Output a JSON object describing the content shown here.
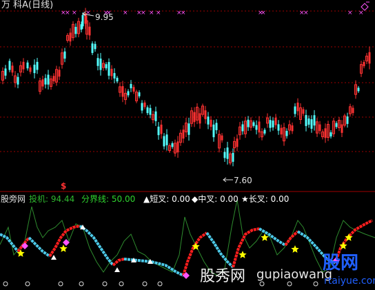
{
  "header": {
    "title": "万 科A(日线)"
  },
  "price_panel": {
    "high_label": "9.95",
    "low_label": "7.60"
  },
  "indicator_bar": {
    "name": "股旁网",
    "touji_label": "投机: 94.44",
    "boundary_label": "分界线: 50.00",
    "short_cross": "▲短叉: 0.00",
    "mid_cross": "◆中叉: 0.00",
    "long_cross": "★长叉: 0.00"
  },
  "misc": {
    "dollar": "$"
  },
  "watermark": {
    "text1": "股秀网",
    "text2": "gupiaowang",
    "text3": "rtaiyue.com",
    "logo_text": "股网"
  },
  "colors": {
    "bg": "#000000",
    "up": "#ff3232",
    "down": "#54ffff",
    "title": "#e0e0e0",
    "dashed_grid": "#a00000",
    "purple_mark": "#ff55ff",
    "touji": "#ffffff",
    "boundary": "#00ff00",
    "short_cross": "#ffffff",
    "mid_cross": "#ff55ff",
    "long_cross": "#ffff00",
    "thin_line": "#2e8b2e",
    "indicator_cyan": "#4cc9e8",
    "indicator_red": "#ff1e1e"
  }
}
